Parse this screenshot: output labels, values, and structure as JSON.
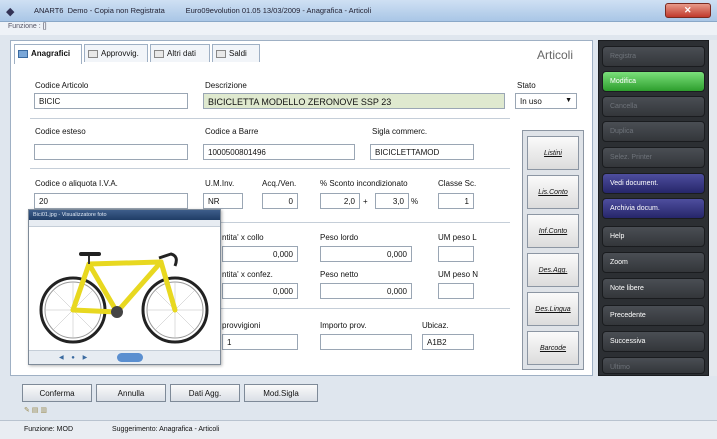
{
  "window": {
    "title": "ANART6  Demo - Copia non Registrata          Euro09evolution 01.05 13/03/2009 - Anagrafica - Articoli",
    "menu": "Funzione : []"
  },
  "tabs": [
    {
      "label": "Anagrafici"
    },
    {
      "label": "Approvvig."
    },
    {
      "label": "Altri dati"
    },
    {
      "label": "Saldi"
    }
  ],
  "section_title": "Articoli",
  "fields": {
    "codice_articolo": {
      "label": "Codice Articolo",
      "value": "BICIC"
    },
    "descrizione": {
      "label": "Descrizione",
      "value": "BICICLETTA MODELLO ZERONOVE SSP 23"
    },
    "stato": {
      "label": "Stato",
      "value": "In uso"
    },
    "codice_esteso": {
      "label": "Codice esteso",
      "value": ""
    },
    "codice_barre": {
      "label": "Codice a Barre",
      "value": "1000500801496"
    },
    "sigla_commerc": {
      "label": "Sigla commerc.",
      "value": "BICICLETTAMOD"
    },
    "codice_iva": {
      "label": "Codice o aliquota I.V.A.",
      "value": "20"
    },
    "um_inv": {
      "label": "U.M.Inv.",
      "value": "NR"
    },
    "acq_ven": {
      "label": "Acq./Ven.",
      "value": "0"
    },
    "sconto_label": "% Sconto incondizionato",
    "sconto1": "2,0",
    "sconto_plus": "+",
    "sconto2": "3,0",
    "sconto_pct": "%",
    "classe_sc": {
      "label": "Classe Sc.",
      "value": "1"
    },
    "qta_collo": {
      "label": "ntita' x collo",
      "value": "0,000"
    },
    "peso_lordo": {
      "label": "Peso lordo",
      "value": "0,000"
    },
    "um_peso_l": {
      "label": "UM peso L",
      "value": ""
    },
    "qta_confez": {
      "label": "ntita' x confez.",
      "value": "0,000"
    },
    "peso_netto": {
      "label": "Peso netto",
      "value": "0,000"
    },
    "um_peso_n": {
      "label": "UM peso N",
      "value": ""
    },
    "provvigioni": {
      "label": "provvigioni",
      "value": "1"
    },
    "importo_prov": {
      "label": "Importo prov.",
      "value": ""
    },
    "ubicaz": {
      "label": "Ubicaz.",
      "value": "A1B2"
    }
  },
  "side_buttons": [
    "Listini",
    "Lis.Conto",
    "Inf.Conto",
    "Des.Agg.",
    "Des.Lingua",
    "Barcode"
  ],
  "image_window": {
    "title": "Bici01.jpg - Visualizzatore foto"
  },
  "bottom_buttons": [
    "Conferma",
    "Annulla",
    "Dati Agg.",
    "Mod.Sigla"
  ],
  "status": {
    "funzione": "Funzione: MOD",
    "suggerimento": "Suggerimento:  Anagrafica - Articoli"
  },
  "right_buttons": [
    {
      "label": "Registra",
      "style": "dis"
    },
    {
      "label": "Modifica",
      "style": "green"
    },
    {
      "label": "Cancella",
      "style": "dis"
    },
    {
      "label": "Duplica",
      "style": "dis"
    },
    {
      "label": "Selez. Printer",
      "style": "dis"
    },
    {
      "label": "Vedi document.",
      "style": "blue"
    },
    {
      "label": "Archivia docum.",
      "style": "blue"
    },
    {
      "label": "Help",
      "style": ""
    },
    {
      "label": "Zoom",
      "style": ""
    },
    {
      "label": "Note libere",
      "style": ""
    },
    {
      "label": "Precedente",
      "style": ""
    },
    {
      "label": "Successiva",
      "style": ""
    },
    {
      "label": "Ultimo",
      "style": "dis"
    }
  ],
  "colors": {
    "accent_green": "#3fbf3f",
    "accent_blue": "#3a3a88",
    "highlight_field": "#dfe9cf",
    "bike_frame": "#e8d820"
  }
}
